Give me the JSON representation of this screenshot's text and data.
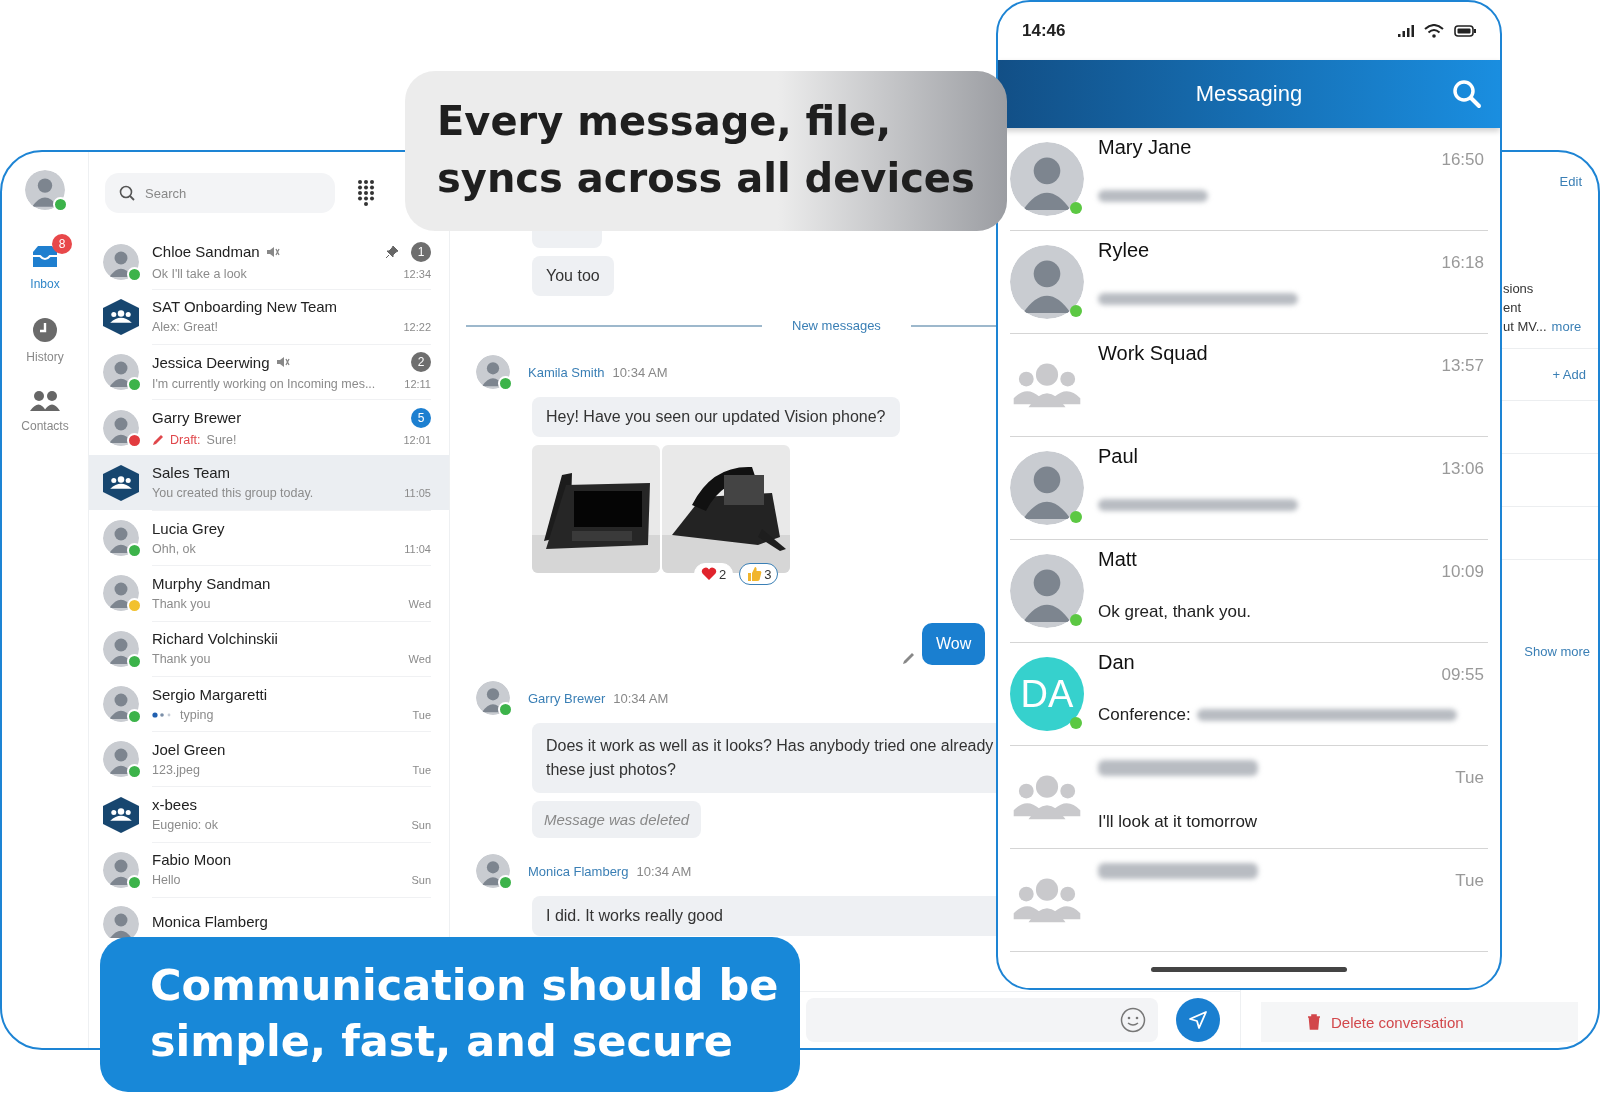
{
  "desktop": {
    "nav": [
      {
        "label": "Inbox",
        "selected": true,
        "badge": "8"
      },
      {
        "label": "History",
        "selected": false
      },
      {
        "label": "Contacts",
        "selected": false
      }
    ],
    "search": {
      "placeholder": "Search"
    },
    "conversations": [
      {
        "kind": "person",
        "name": "Chloe Sandman",
        "color": "#3cb34a",
        "muted": true,
        "pinned": true,
        "badge": {
          "count": "1",
          "color": "#6e6e6e"
        },
        "preview": "Ok I'll take a look",
        "time": "12:34",
        "selected": false
      },
      {
        "kind": "group",
        "name": "SAT Onboarding New Team",
        "preview": "Alex: Great!",
        "time": "12:22",
        "selected": false
      },
      {
        "kind": "person",
        "name": "Jessica Deerwing",
        "color": "#3cb34a",
        "muted": true,
        "badge": {
          "count": "2",
          "color": "#6e6e6e"
        },
        "preview": "I'm currently working on Incoming mes...",
        "time": "12:11",
        "selected": false
      },
      {
        "kind": "person",
        "name": "Garry Brewer",
        "color": "#e23b3f",
        "badge": {
          "count": "5",
          "color": "#1c7fd0"
        },
        "draft_label": "Draft:",
        "preview": "Sure!",
        "time": "12:01",
        "selected": false
      },
      {
        "kind": "group",
        "name": "Sales Team",
        "preview": "You created this group today.",
        "time": "11:05",
        "selected": true
      },
      {
        "kind": "person",
        "name": "Lucia Grey",
        "color": "#3cb34a",
        "preview": "Ohh, ok",
        "time": "11:04",
        "selected": false
      },
      {
        "kind": "person",
        "name": "Murphy Sandman",
        "color": "#f2c12e",
        "preview": "Thank you",
        "time": "Wed",
        "selected": false
      },
      {
        "kind": "person",
        "name": "Richard Volchinskii",
        "color": "#3cb34a",
        "preview": "Thank you",
        "time": "Wed",
        "selected": false
      },
      {
        "kind": "person",
        "name": "Sergio Margaretti",
        "color": "#3cb34a",
        "typing": true,
        "preview": "typing",
        "time": "Tue",
        "selected": false
      },
      {
        "kind": "person",
        "name": "Joel Green",
        "color": "#3cb34a",
        "preview": "123.jpeg",
        "time": "Tue",
        "selected": false
      },
      {
        "kind": "group",
        "name": "x-bees",
        "preview": "Eugenio: ok",
        "time": "Sun",
        "selected": false
      },
      {
        "kind": "person",
        "name": "Fabio Moon",
        "color": "#3cb34a",
        "preview": "Hello",
        "time": "Sun",
        "selected": false
      },
      {
        "kind": "person",
        "name": "Monica Flamberg",
        "selected": false
      }
    ],
    "chat": [
      {
        "kind": "covered"
      },
      {
        "kind": "bubble",
        "text": "You too"
      },
      {
        "kind": "divider",
        "text": "New messages"
      },
      {
        "kind": "header",
        "author": "Kamila Smith",
        "time": "10:34 AM",
        "color": "#3cb34a"
      },
      {
        "kind": "bubble",
        "text": "Hey! Have you seen our updated Vision phone?"
      },
      {
        "kind": "images",
        "images": [
          {
            "kind": "picture"
          },
          {
            "kind": "picture"
          }
        ],
        "reactions": [
          {
            "kind": "heart",
            "count": "2",
            "selected": false
          },
          {
            "kind": "thumbs-up",
            "count": "3",
            "selected": true
          }
        ]
      },
      {
        "kind": "outgoing",
        "text": "Wow"
      },
      {
        "kind": "header",
        "author": "Garry Brewer",
        "time": "10:34 AM",
        "color": "#3cb34a"
      },
      {
        "kind": "bubble",
        "text": "Does it work as well as it looks? Has anybody tried one already\nthese just photos?"
      },
      {
        "kind": "deleted",
        "text": "Message was deleted"
      },
      {
        "kind": "header",
        "author": "Monica Flamberg",
        "time": "10:34 AM",
        "color": "#3cb34a"
      },
      {
        "kind": "bubble",
        "text": "I did. It works really good"
      }
    ],
    "details": {
      "edit": "Edit",
      "description": [
        "sions",
        "ent",
        "ut MV..."
      ],
      "more": "more",
      "add": "+ Add",
      "show_more": "Show more",
      "delete": "Delete conversation"
    }
  },
  "phone": {
    "time": "14:46",
    "title": "Messaging",
    "rows": [
      {
        "kind": "person",
        "name": "Mary Jane",
        "time": "16:50",
        "online": true,
        "preview_hidden": true
      },
      {
        "kind": "person",
        "name": "Rylee",
        "time": "16:18",
        "online": true,
        "preview_hidden": true
      },
      {
        "kind": "group",
        "name": "Work Squad",
        "time": "13:57",
        "online": false
      },
      {
        "kind": "person",
        "name": "Paul",
        "time": "13:06",
        "online": true,
        "preview_hidden": true
      },
      {
        "kind": "person",
        "name": "Matt",
        "time": "10:09",
        "online": true,
        "preview": "Ok great, thank you."
      },
      {
        "kind": "initials",
        "name": "Dan",
        "time": "09:55",
        "initials": "DA",
        "online": true,
        "preview": "Conference:",
        "preview_hidden": true
      },
      {
        "kind": "group",
        "name_hidden": true,
        "time": "Tue",
        "online": false,
        "preview": "I'll look at it tomorrow"
      },
      {
        "kind": "group",
        "name_hidden": true,
        "time": "Tue",
        "online": false
      }
    ]
  },
  "callouts": [
    {
      "kind": "light",
      "lines": [
        "Every message, file,",
        "syncs across all devices"
      ]
    },
    {
      "kind": "blue",
      "lines": [
        "Communication should be",
        "simple, fast, and secure"
      ]
    }
  ]
}
